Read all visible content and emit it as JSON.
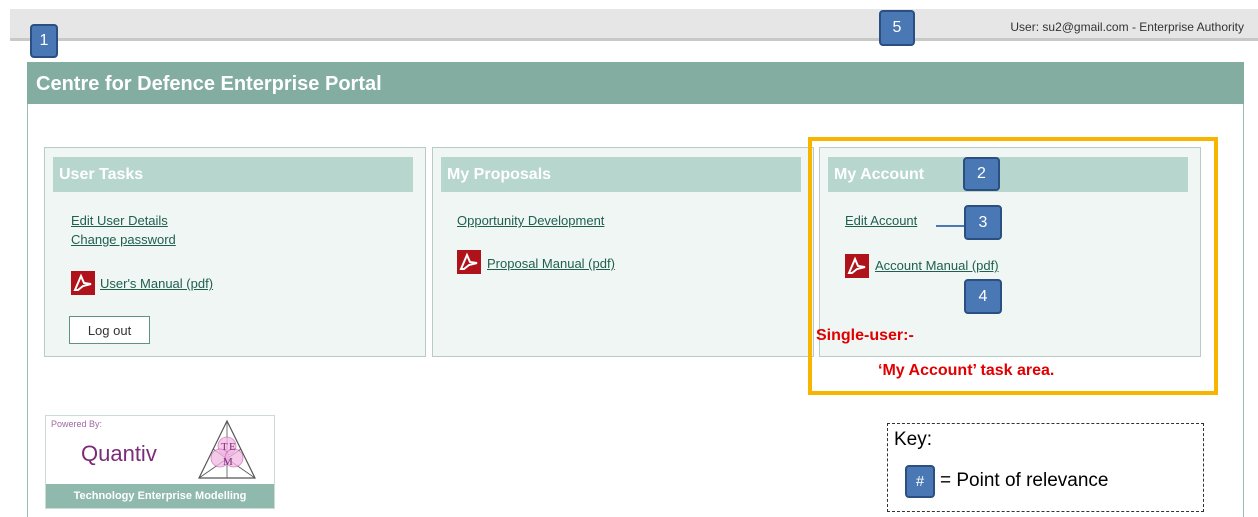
{
  "top_bar": {
    "user_info": "User:  su2@gmail.com - Enterprise Authority"
  },
  "callouts": {
    "b1": "1",
    "b2": "2",
    "b3": "3",
    "b4": "4",
    "b5": "5"
  },
  "portal": {
    "title": "Centre for Defence Enterprise Portal"
  },
  "user_tasks": {
    "heading": "User Tasks",
    "edit_user_details": "Edit User Details",
    "change_password": "Change password",
    "users_manual": "User's Manual (pdf)",
    "log_out": "Log out"
  },
  "my_proposals": {
    "heading": "My Proposals",
    "opportunity_development": "Opportunity Development",
    "proposal_manual": "Proposal Manual (pdf)"
  },
  "my_account": {
    "heading": "My Account",
    "edit_account": "Edit Account",
    "account_manual": "Account Manual (pdf)"
  },
  "annotation": {
    "line1": "Single-user:-",
    "line2": "‘My Account’ task area."
  },
  "powered_by": {
    "label": "Powered By:",
    "brand": "Quantiv",
    "logo_letters": [
      "T",
      "E",
      "M"
    ],
    "footer": "Technology Enterprise Modelling"
  },
  "key": {
    "title": "Key:",
    "badge": "#",
    "meaning": "= Point of relevance"
  },
  "colors": {
    "header_green": "#82ada0",
    "panel_head": "#b6d6ce",
    "panel_bg": "#eff6f4",
    "callout_blue": "#4a78b4",
    "highlight_orange": "#f7b500",
    "annotation_red": "#e00000"
  }
}
